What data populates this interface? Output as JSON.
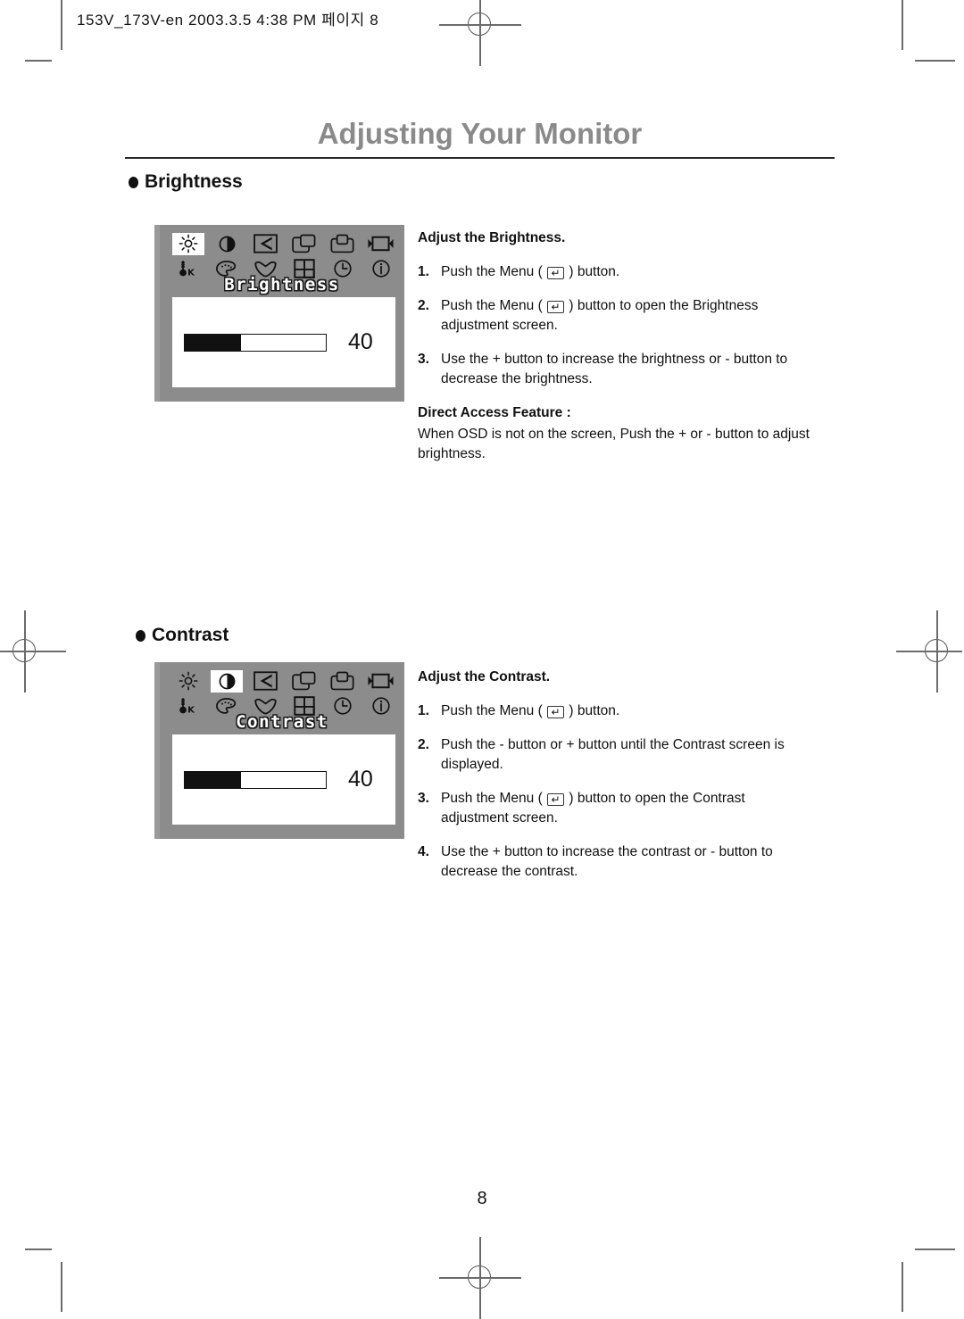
{
  "document": {
    "header_slug": "153V_173V-en  2003.3.5 4:38 PM  페이지 8",
    "title": "Adjusting Your Monitor",
    "page_number": "8"
  },
  "colors": {
    "title_gray": "#8a8a8a",
    "osd_background": "#8c8c8c",
    "osd_border": "#9a9a9a",
    "osd_screen": "#ffffff",
    "bar_fill": "#111111",
    "text": "#111111",
    "crop_mark": "#6b6b6b"
  },
  "osd_icons": {
    "row1": [
      {
        "name": "brightness-sun-icon",
        "label": "Brightness"
      },
      {
        "name": "contrast-half-circle-icon",
        "label": "Contrast"
      },
      {
        "name": "image-lock-triangle-icon",
        "label": "Image Lock"
      },
      {
        "name": "h-position-icon",
        "label": "H-Position"
      },
      {
        "name": "v-position-icon",
        "label": "V-Position"
      },
      {
        "name": "h-size-icon",
        "label": "H-Size"
      }
    ],
    "row2": [
      {
        "name": "color-temperature-icon",
        "label": "Color Temperature"
      },
      {
        "name": "color-palette-icon",
        "label": "Color Control"
      },
      {
        "name": "image-reset-icon",
        "label": "Image Reset"
      },
      {
        "name": "osd-position-icon",
        "label": "OSD Position"
      },
      {
        "name": "osd-timer-icon",
        "label": "Display Time"
      },
      {
        "name": "information-icon",
        "label": "Information"
      }
    ]
  },
  "sections": [
    {
      "heading": "Brightness",
      "osd": {
        "label": "Brightness",
        "value": "40",
        "bar_percent": 40,
        "selected_icon_row": 1,
        "selected_icon_index": 0
      },
      "instructions": {
        "lead": "Adjust the Brightness.",
        "steps": [
          {
            "num": "1.",
            "parts": [
              {
                "t": "text",
                "v": "Push the Menu ( "
              },
              {
                "t": "key",
                "v": "↵"
              },
              {
                "t": "text",
                "v": " ) button."
              }
            ]
          },
          {
            "num": "2.",
            "parts": [
              {
                "t": "text",
                "v": "Push the Menu ( "
              },
              {
                "t": "key",
                "v": "↵"
              },
              {
                "t": "text",
                "v": " ) button to open the Brightness adjustment  screen."
              }
            ]
          },
          {
            "num": "3.",
            "parts": [
              {
                "t": "text",
                "v": "Use the + button to increase the brightness or - button to decrease the brightness."
              }
            ]
          }
        ],
        "direct_access": {
          "title": "Direct Access Feature :",
          "body": "When OSD is not on the screen, Push the + or - button to adjust brightness."
        }
      }
    },
    {
      "heading": "Contrast",
      "osd": {
        "label": "Contrast",
        "value": "40",
        "bar_percent": 40,
        "selected_icon_row": 1,
        "selected_icon_index": 1
      },
      "instructions": {
        "lead": "Adjust the Contrast.",
        "steps": [
          {
            "num": "1.",
            "parts": [
              {
                "t": "text",
                "v": "Push the Menu ( "
              },
              {
                "t": "key",
                "v": "↵"
              },
              {
                "t": "text",
                "v": " ) button."
              }
            ]
          },
          {
            "num": "2.",
            "parts": [
              {
                "t": "text",
                "v": "Push the - button or + button until the Contrast screen is displayed."
              }
            ]
          },
          {
            "num": "3.",
            "parts": [
              {
                "t": "text",
                "v": "Push the Menu ( "
              },
              {
                "t": "key",
                "v": "↵"
              },
              {
                "t": "text",
                "v": " ) button to open the Contrast adjustment screen."
              }
            ]
          },
          {
            "num": "4.",
            "parts": [
              {
                "t": "text",
                "v": "Use the + button to increase the contrast or - button to decrease the contrast."
              }
            ]
          }
        ],
        "direct_access": null
      }
    }
  ]
}
